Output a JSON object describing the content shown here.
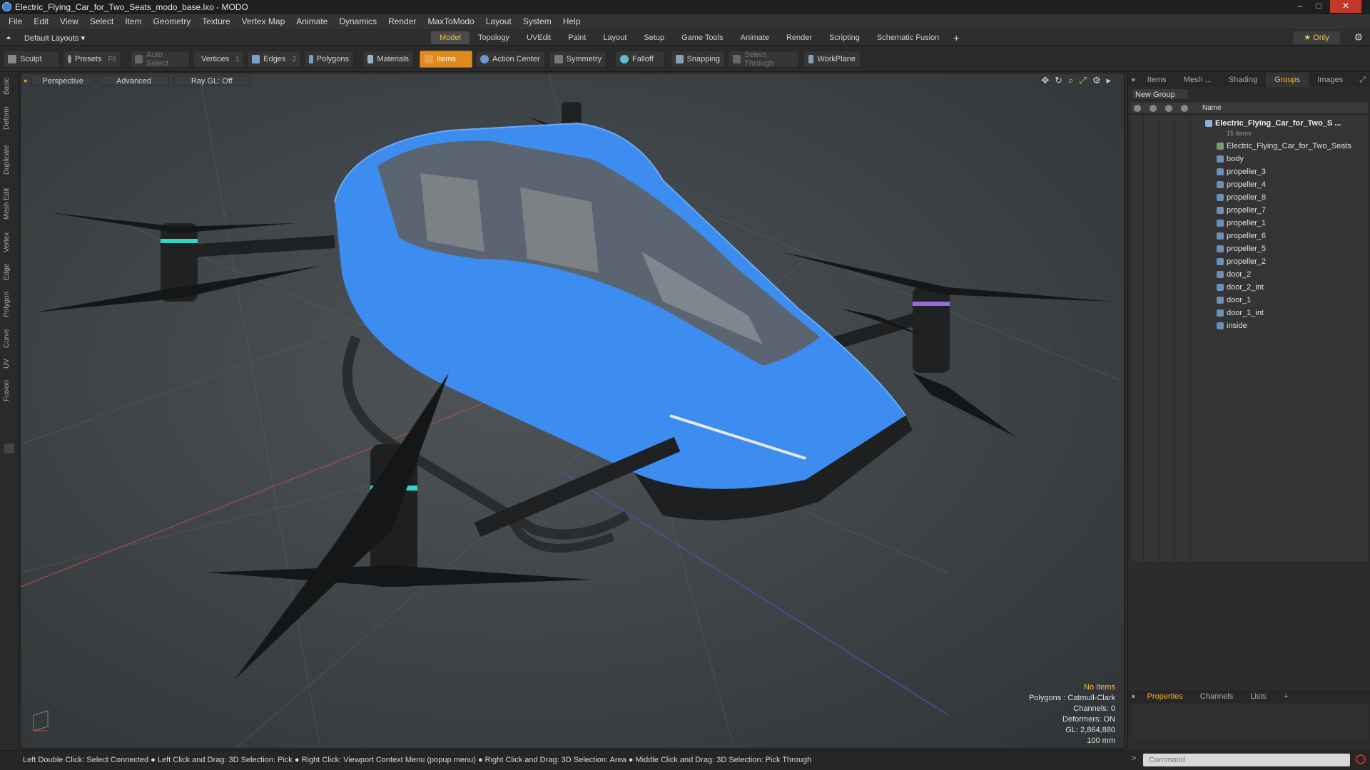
{
  "window": {
    "title": "Electric_Flying_Car_for_Two_Seats_modo_base.lxo - MODO",
    "minimize": "–",
    "maximize": "□",
    "close": "✕"
  },
  "menu": [
    "File",
    "Edit",
    "View",
    "Select",
    "Item",
    "Geometry",
    "Texture",
    "Vertex Map",
    "Animate",
    "Dynamics",
    "Render",
    "MaxToModo",
    "Layout",
    "System",
    "Help"
  ],
  "layoutbar": {
    "layout_label": "Default Layouts ▾",
    "tabs": [
      "Model",
      "Topology",
      "UVEdit",
      "Paint",
      "Layout",
      "Setup",
      "Game Tools",
      "Animate",
      "Render",
      "Scripting",
      "Schematic Fusion"
    ],
    "active_tab": "Model",
    "add": "+",
    "only_label": "★ Only"
  },
  "toolbar": {
    "sculpt": "Sculpt",
    "presets": "Presets",
    "presets_key": "F6",
    "auto_select": "Auto Select",
    "vertices": "Vertices",
    "vertices_count": "1",
    "edges": "Edges",
    "edges_count": "2",
    "polygons": "Polygons",
    "materials": "Materials",
    "items": "Items",
    "action_center": "Action Center",
    "symmetry": "Symmetry",
    "falloff": "Falloff",
    "snapping": "Snapping",
    "select_through": "Select Through",
    "workplane": "WorkPlane"
  },
  "left_tabs": [
    "Basic",
    "Deform",
    "Duplicate",
    "Mesh Edit",
    "Vertex",
    "Edge",
    "Polygon",
    "Curve",
    "UV",
    "Fusion"
  ],
  "viewport": {
    "view_mode": "Perspective",
    "shading": "Advanced",
    "raygl": "Ray GL: Off",
    "info": {
      "selection": "No Items",
      "polygons": "Polygons : Catmull-Clark",
      "channels": "Channels: 0",
      "deformers": "Deformers: ON",
      "gl": "GL: 2,864,880",
      "scale": "100 mm"
    },
    "colors": {
      "body": "#3d8cf0",
      "dark": "#1e1f21",
      "accent_teal": "#2fd6c8",
      "accent_purple": "#9a6ad8"
    }
  },
  "right_panel": {
    "tabs": [
      "Items",
      "Mesh ...",
      "Shading",
      "Groups",
      "Images"
    ],
    "active_tab": "Groups",
    "new_group": "New Group",
    "column_name": "Name",
    "root": {
      "name": "Electric_Flying_Car_for_Two_S ...",
      "sub": "15 Items"
    },
    "items": [
      "Electric_Flying_Car_for_Two_Seats",
      "body",
      "propeller_3",
      "propeller_4",
      "propeller_8",
      "propeller_7",
      "propeller_1",
      "propeller_6",
      "propeller_5",
      "propeller_2",
      "door_2",
      "door_2_int",
      "door_1",
      "door_1_int",
      "inside"
    ],
    "bottom_tabs": [
      "Properties",
      "Channels",
      "Lists",
      "+"
    ],
    "bottom_active": "Properties"
  },
  "statusbar": {
    "hint": "Left Double Click: Select Connected ● Left Click and Drag: 3D Selection: Pick ● Right Click: Viewport Context Menu (popup menu) ● Right Click and Drag: 3D Selection: Area ● Middle Click and Drag: 3D Selection: Pick Through"
  },
  "command": {
    "placeholder": "Command",
    "prompt": ">"
  }
}
